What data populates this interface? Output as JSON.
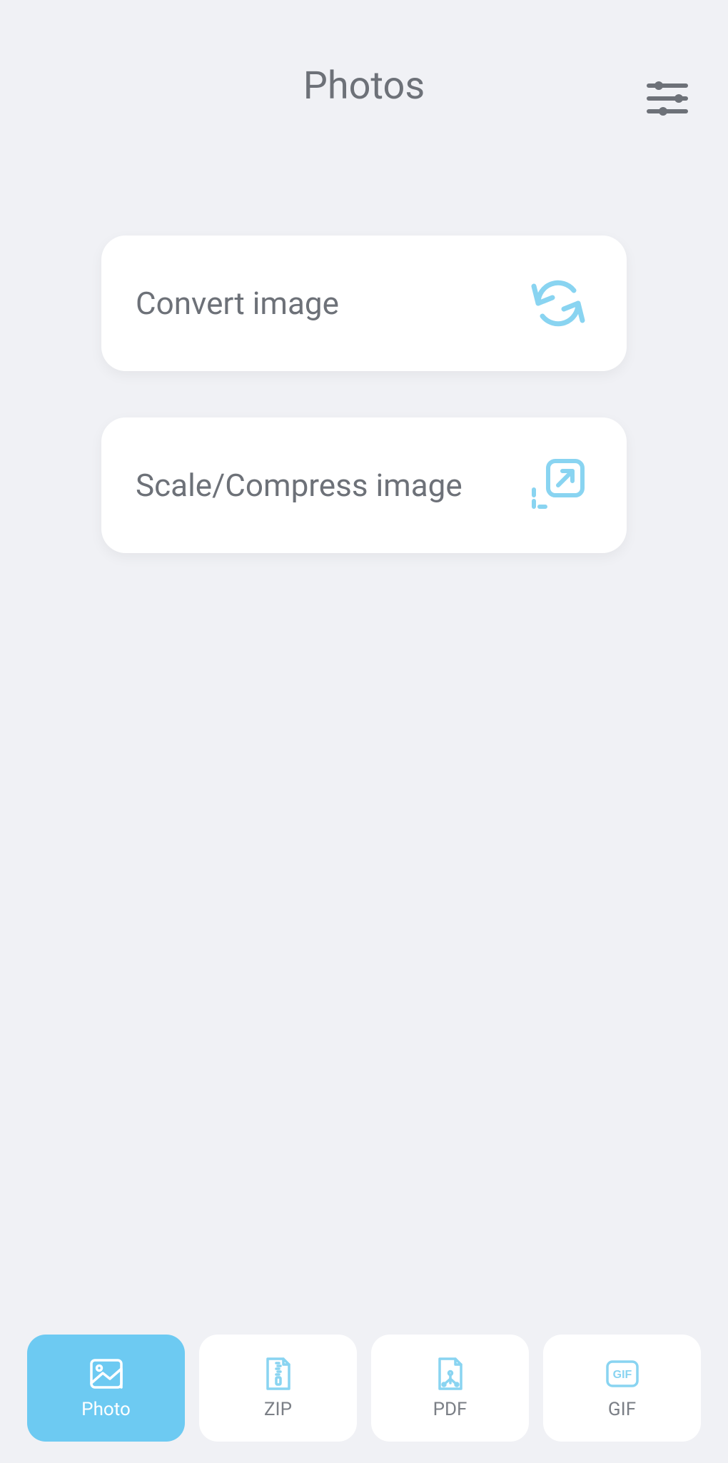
{
  "header": {
    "title": "Photos"
  },
  "cards": {
    "convert": {
      "label": "Convert image"
    },
    "scale": {
      "label": "Scale/Compress image"
    }
  },
  "nav": {
    "photo": {
      "label": "Photo",
      "active": true
    },
    "zip": {
      "label": "ZIP",
      "active": false
    },
    "pdf": {
      "label": "PDF",
      "active": false
    },
    "gif": {
      "label": "GIF",
      "active": false
    }
  },
  "colors": {
    "accent": "#6dcaf2",
    "iconBlue": "#89d4f1",
    "text": "#6d7178"
  }
}
